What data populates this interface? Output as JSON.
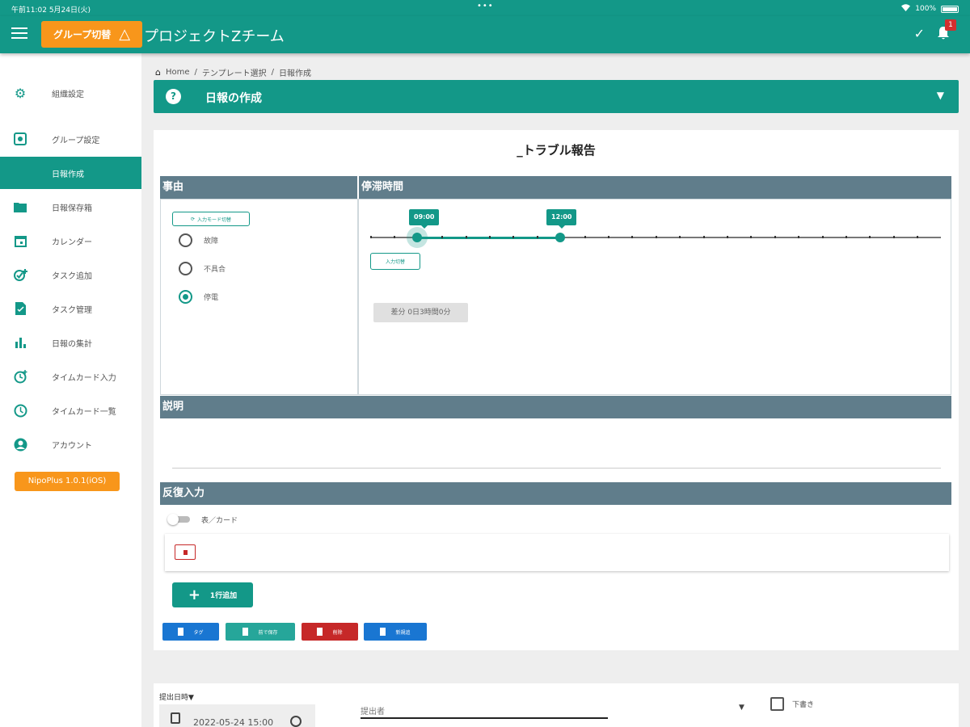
{
  "status_bar": {
    "time": "午前11:02",
    "date": "5月24日(火)",
    "battery": "100%"
  },
  "app_bar": {
    "group_switch_label": "グループ切替",
    "title": "プロジェクトZチーム",
    "notification_count": "1"
  },
  "sidebar": {
    "items": [
      {
        "label": "組織設定",
        "icon": "gear-icon"
      },
      {
        "label": "グループ設定",
        "icon": "group-settings-icon"
      },
      {
        "label": "日報作成",
        "icon": "",
        "active": true
      },
      {
        "label": "日報保存箱",
        "icon": "folder-icon"
      },
      {
        "label": "カレンダー",
        "icon": "calendar-icon"
      },
      {
        "label": "タスク追加",
        "icon": "task-add-icon"
      },
      {
        "label": "タスク管理",
        "icon": "document-icon"
      },
      {
        "label": "日報の集計",
        "icon": "bar-chart-icon"
      },
      {
        "label": "タイムカード入力",
        "icon": "clock-plus-icon"
      },
      {
        "label": "タイムカード一覧",
        "icon": "clock-icon"
      },
      {
        "label": "アカウント",
        "icon": "account-icon"
      }
    ],
    "version": "NipoPlus 1.0.1(iOS)"
  },
  "breadcrumb": {
    "home": "Home",
    "template": "テンプレート選択",
    "current": "日報作成"
  },
  "section": {
    "title": "日報の作成"
  },
  "form": {
    "title": "_トラブル報告",
    "reason": {
      "header": "事由",
      "input_mode_button": "入力モード切替",
      "options": [
        "故障",
        "不具合",
        "停電"
      ],
      "selected": "停電"
    },
    "downtime": {
      "header": "停滞時間",
      "start_label": "09:00",
      "end_label": "12:00",
      "input_switch_button": "入力切替",
      "diff_text": "差分 0日3時間0分"
    },
    "description": {
      "header": "説明"
    },
    "repeat": {
      "header": "反復入力",
      "toggle_label": "表／カード",
      "add_row_label": "1行追加"
    },
    "actions": [
      {
        "label": "タグ",
        "color": "#1976d2"
      },
      {
        "label": "前で保存",
        "color": "#26a69a"
      },
      {
        "label": "削除",
        "color": "#c62828"
      },
      {
        "label": "新規追",
        "color": "#1976d2"
      }
    ]
  },
  "submission": {
    "date_label": "提出日時▼",
    "date_value": "2022-05-24 15:00",
    "submitter_placeholder": "提出者",
    "draft_label": "下書き"
  },
  "colors": {
    "primary": "#139888",
    "accent": "#f8961b",
    "header_gray": "#607d8b"
  }
}
